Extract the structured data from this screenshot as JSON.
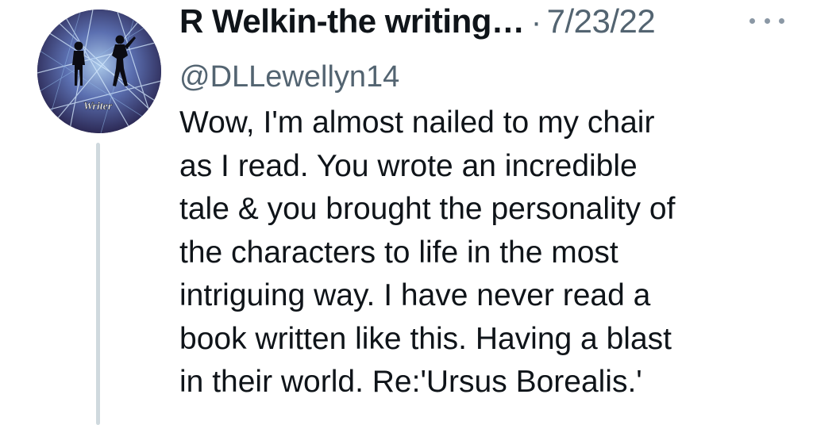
{
  "tweet": {
    "display_name": "R Welkin-the writing…",
    "separator": "·",
    "date": "7/23/22",
    "handle": "@DLLewellyn14",
    "avatar_badge": "Writer",
    "more_icon": "more-horizontal-icon",
    "body_lines": [
      "Wow, I'm almost nailed to my chair",
      "as I read. You wrote an incredible",
      "tale & you brought the personality of",
      "the characters to life in the most",
      "intriguing way. I have never read a",
      "book written like this. Having a blast",
      "in their world. Re:'Ursus Borealis.'"
    ]
  },
  "colors": {
    "text_primary": "#0f1419",
    "text_secondary": "#536471",
    "thread_line": "#cfd9de",
    "avatar_bg": "#1f1b3a"
  }
}
